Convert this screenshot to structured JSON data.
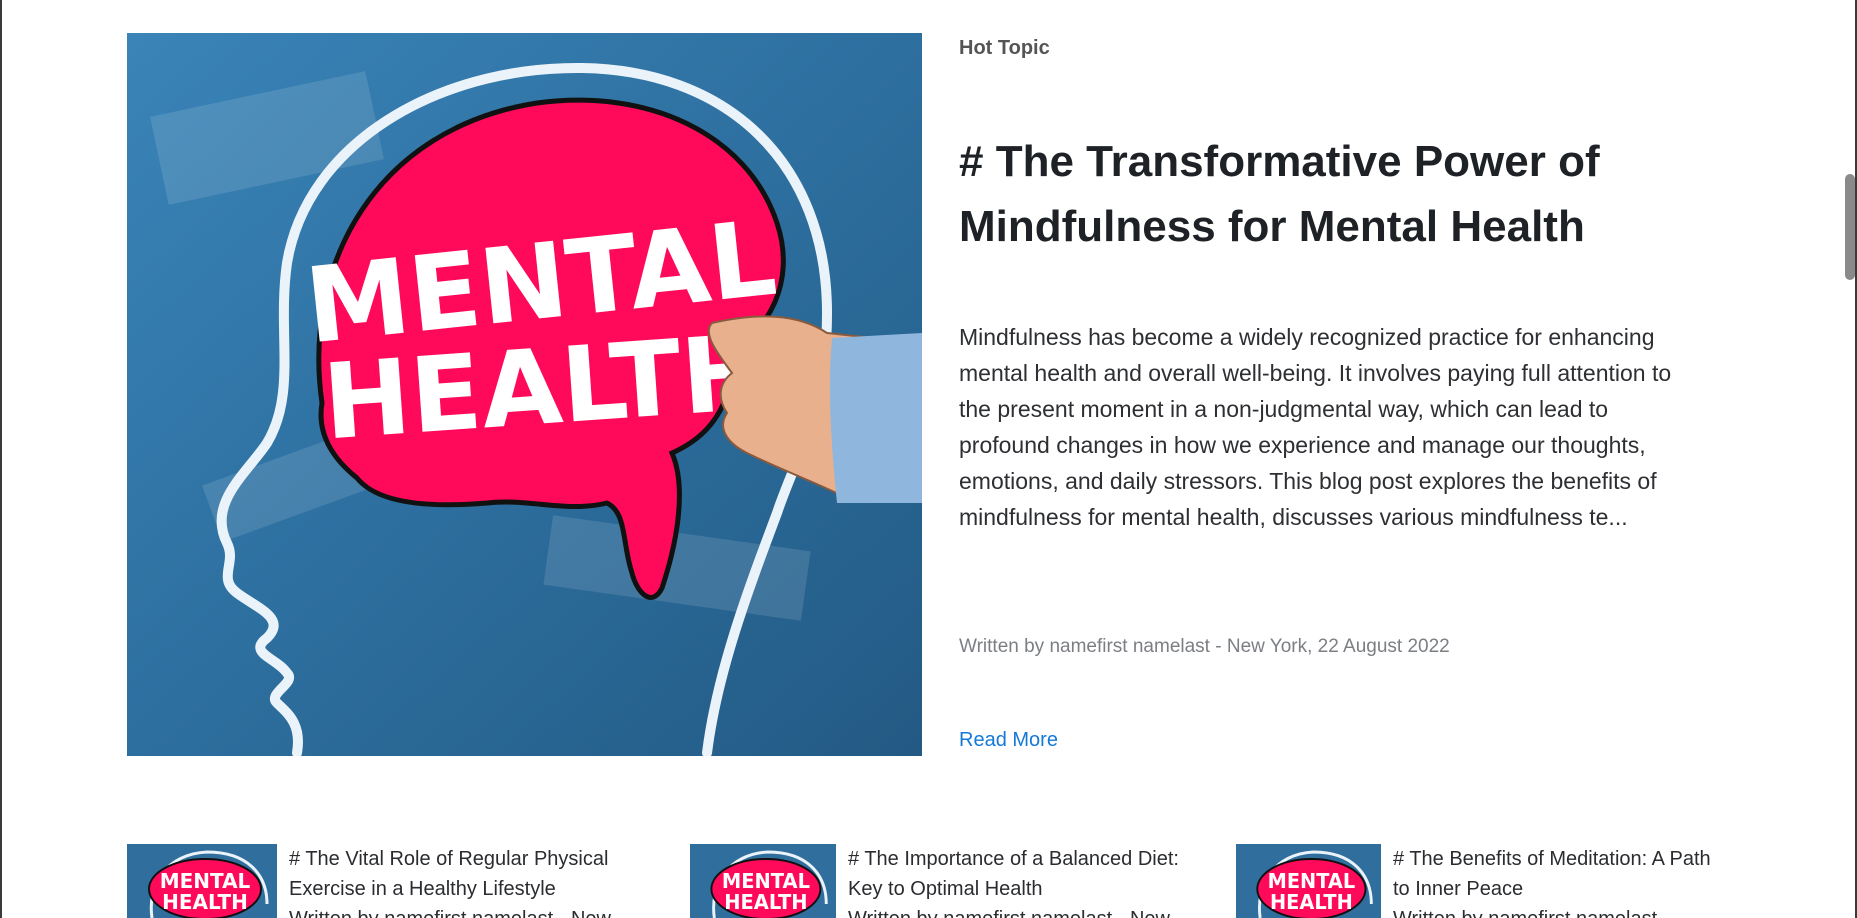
{
  "hero": {
    "kicker": "Hot Topic",
    "title": "# The Transformative Power of Mindfulness for Mental Health",
    "excerpt": "Mindfulness has become a widely recognized practice for enhancing mental health and overall well-being. It involves paying full attention to the present moment in a non-judgmental way, which can lead to profound changes in how we experience and manage our thoughts, emotions, and daily stressors. This blog post explores the benefits of mindfulness for mental health, discusses various mindfulness te...",
    "byline": "Written by namefirst namelast - New York, 22 August 2022",
    "read_more": "Read More",
    "image": {
      "word1": "MENTAL",
      "word2": "HEALTH"
    }
  },
  "cards": [
    {
      "title": "# The Vital Role of Regular Physical Exercise in a Healthy Lifestyle",
      "meta": "Written by namefirst namelast - New"
    },
    {
      "title": "# The Importance of a Balanced Diet: Key to Optimal Health",
      "meta": "Written by namefirst namelast - New"
    },
    {
      "title": "# The Benefits of Meditation: A Path to Inner Peace",
      "meta": "Written by namefirst namelast -"
    }
  ],
  "colors": {
    "accent_link": "#1479d8",
    "image_blue": "#2f6e9d",
    "brain_pink": "#ff0a5a"
  }
}
